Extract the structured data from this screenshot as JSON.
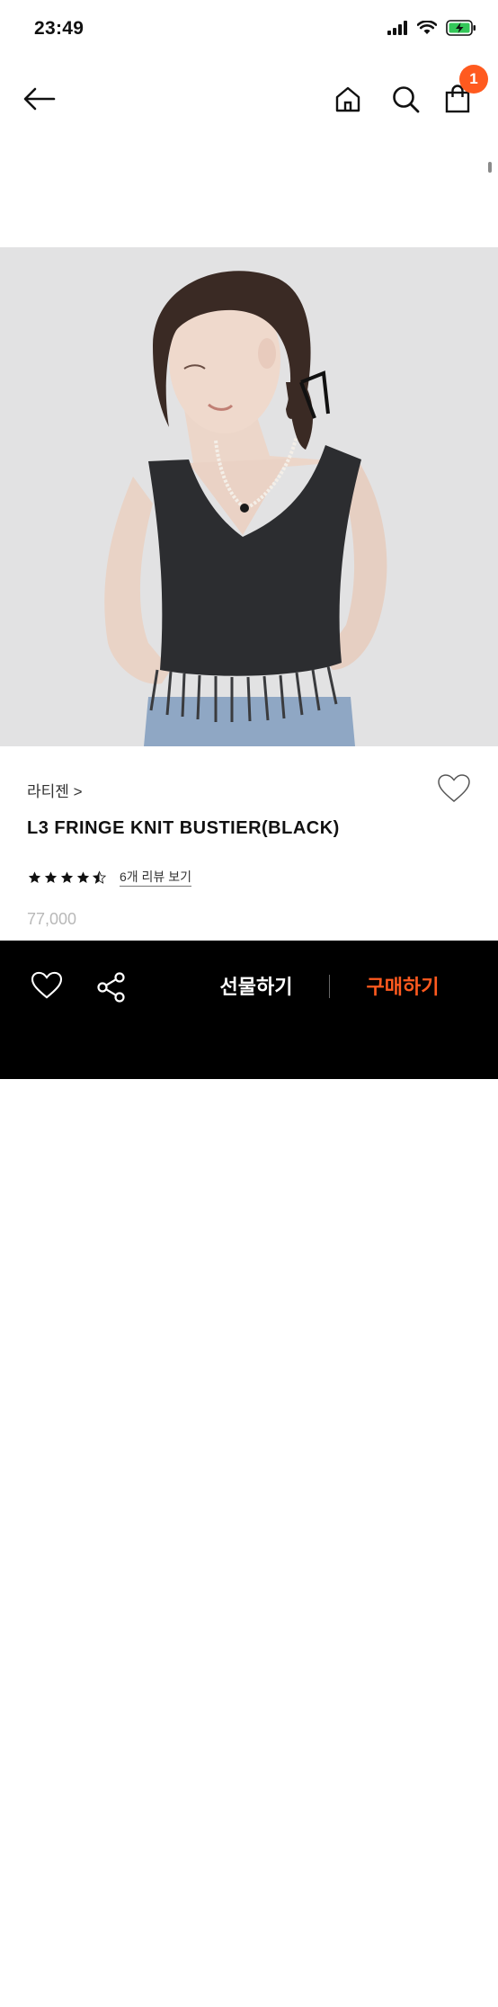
{
  "status_bar": {
    "time": "23:49"
  },
  "header": {
    "back_icon": "arrow-left-icon",
    "home_icon": "home-icon",
    "search_icon": "search-icon",
    "cart_icon": "shopping-bag-icon",
    "cart_count": "1"
  },
  "product": {
    "brand": "라티젠 >",
    "name": "L3 FRINGE KNIT BUSTIER(BLACK)",
    "rating": 4.5,
    "reviews_label": "6개 리뷰 보기",
    "price": "77,000"
  },
  "bottom_bar": {
    "gift_label": "선물하기",
    "buy_label": "구매하기"
  },
  "colors": {
    "accent": "#ff5a1f",
    "bottom_bar_bg": "#000000",
    "price_text": "#b8b8b8"
  }
}
